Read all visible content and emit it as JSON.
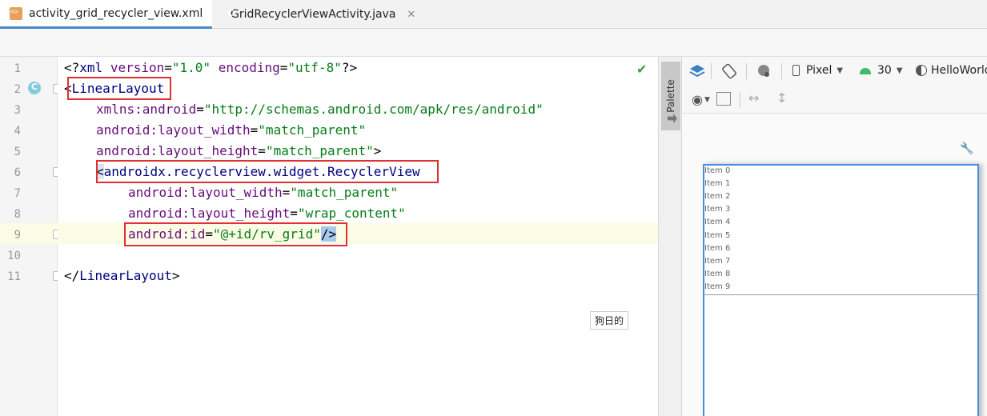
{
  "tabs": [
    {
      "label": "activity_grid_recycler_view.xml",
      "active": true
    },
    {
      "label": "GridRecyclerViewActivity.java",
      "active": false
    }
  ],
  "line_numbers": [
    "1",
    "2",
    "3",
    "4",
    "5",
    "6",
    "7",
    "8",
    "9",
    "10",
    "11"
  ],
  "code": {
    "l1": {
      "open": "<?",
      "tag": "xml",
      "a1": "version",
      "eq1": "=",
      "v1": "\"1.0\"",
      "a2": "encoding",
      "eq2": "=",
      "v2": "\"utf-8\"",
      "close": "?>"
    },
    "l2": {
      "open": "<",
      "tag": "LinearLayout"
    },
    "l3": {
      "ns": "xmlns:",
      "attr": "android",
      "eq": "=",
      "val": "\"http://schemas.android.com/apk/res/android\""
    },
    "l4": {
      "ns": "android:",
      "attr": "layout_width",
      "eq": "=",
      "val": "\"match_parent\""
    },
    "l5": {
      "ns": "android:",
      "attr": "layout_height",
      "eq": "=",
      "val": "\"match_parent\"",
      "close": ">"
    },
    "l6": {
      "open": "<",
      "tag": "androidx.recyclerview.widget.RecyclerView"
    },
    "l7": {
      "ns": "android:",
      "attr": "layout_width",
      "eq": "=",
      "val": "\"match_parent\""
    },
    "l8": {
      "ns": "android:",
      "attr": "layout_height",
      "eq": "=",
      "val": "\"wrap_content\""
    },
    "l9": {
      "ns": "android:",
      "attr": "id",
      "eq": "=",
      "val": "\"@+id/rv_grid\"",
      "close": "/>"
    },
    "l11": {
      "open": "</",
      "tag": "LinearLayout",
      "close": ">"
    }
  },
  "tooltip": "狗日的",
  "stripe": {
    "label": "Palette"
  },
  "design_toolbar": {
    "device": "Pixel",
    "api": "30",
    "theme": "HelloWorld"
  },
  "preview_items": [
    "Item 0",
    "Item 1",
    "Item 2",
    "Item 3",
    "Item 4",
    "Item 5",
    "Item 6",
    "Item 7",
    "Item 8",
    "Item 9"
  ]
}
